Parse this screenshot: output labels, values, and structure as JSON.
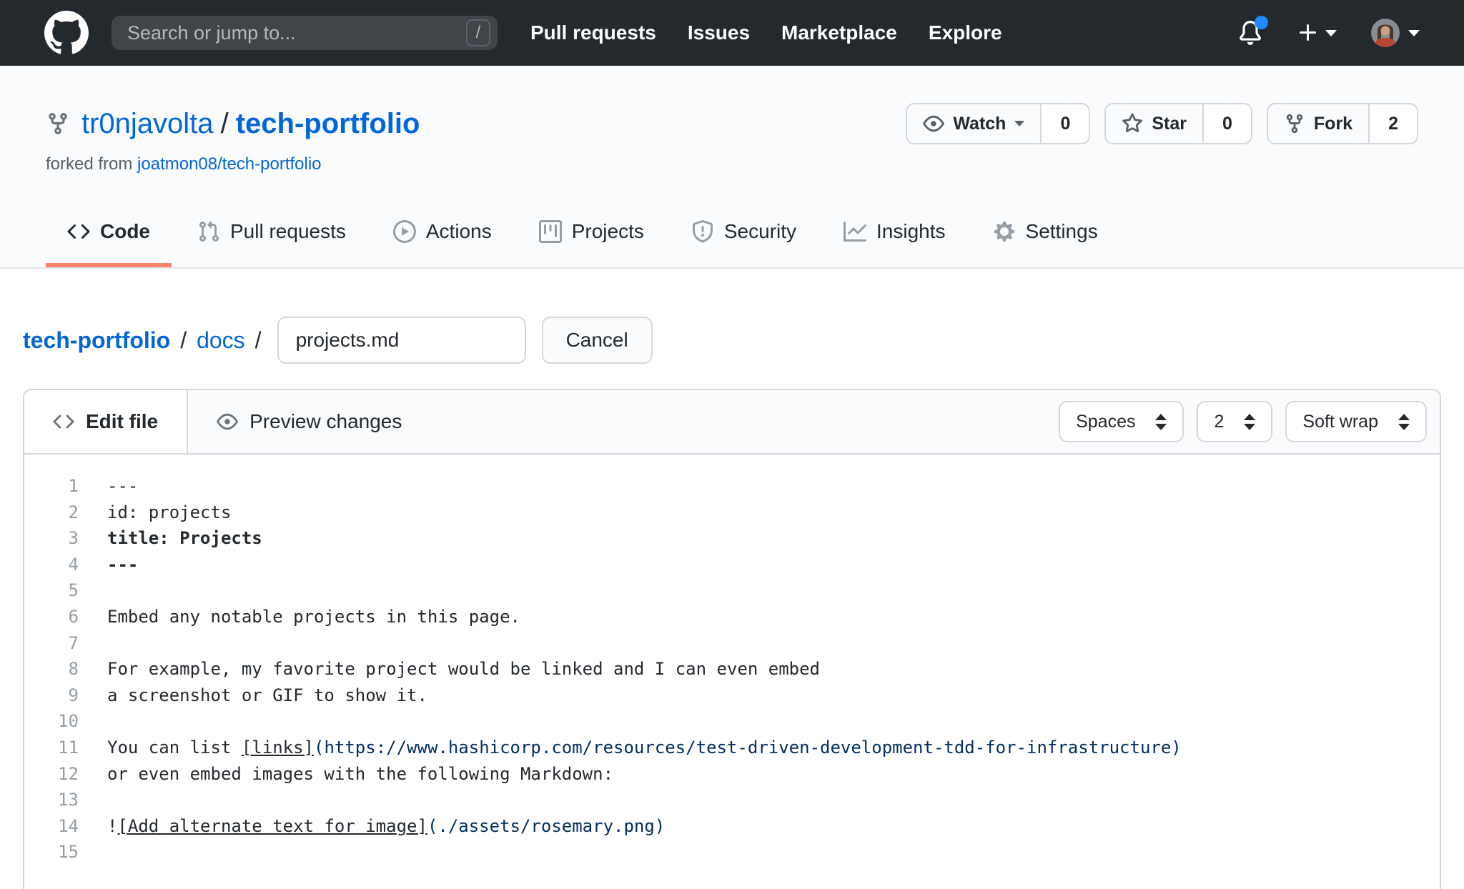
{
  "header": {
    "search": {
      "placeholder": "Search or jump to...",
      "shortcut": "/"
    },
    "nav": [
      "Pull requests",
      "Issues",
      "Marketplace",
      "Explore"
    ]
  },
  "repo": {
    "owner": "tr0njavolta",
    "separator": "/",
    "name": "tech-portfolio",
    "forked_from": {
      "label": "forked from",
      "link": "joatmon08/tech-portfolio"
    },
    "actions": [
      {
        "icon": "eye-icon",
        "label": "Watch",
        "caret": true,
        "count": "0"
      },
      {
        "icon": "star-icon",
        "label": "Star",
        "caret": false,
        "count": "0"
      },
      {
        "icon": "repo-forked-icon",
        "label": "Fork",
        "caret": false,
        "count": "2"
      }
    ],
    "tabs": [
      {
        "icon": "code-icon",
        "label": "Code",
        "active": true
      },
      {
        "icon": "git-pull-request-icon",
        "label": "Pull requests",
        "active": false
      },
      {
        "icon": "play-icon",
        "label": "Actions",
        "active": false
      },
      {
        "icon": "project-icon",
        "label": "Projects",
        "active": false
      },
      {
        "icon": "shield-icon",
        "label": "Security",
        "active": false
      },
      {
        "icon": "graph-icon",
        "label": "Insights",
        "active": false
      },
      {
        "icon": "gear-icon",
        "label": "Settings",
        "active": false
      }
    ]
  },
  "breadcrumb": {
    "repo": "tech-portfolio",
    "separator": "/",
    "folder": "docs",
    "filename": "projects.md",
    "cancel_label": "Cancel"
  },
  "editor": {
    "edit_tab": "Edit file",
    "preview_tab": "Preview changes",
    "settings": [
      {
        "name": "indent-mode-select",
        "value": "Spaces"
      },
      {
        "name": "indent-size-select",
        "value": "2"
      },
      {
        "name": "wrap-mode-select",
        "value": "Soft wrap"
      }
    ],
    "lines": [
      {
        "num": "1",
        "segments": [
          {
            "text": "---",
            "style": "plain"
          }
        ]
      },
      {
        "num": "2",
        "segments": [
          {
            "text": "id: projects",
            "style": "plain"
          }
        ]
      },
      {
        "num": "3",
        "segments": [
          {
            "text": "title: Projects",
            "style": "bold"
          }
        ]
      },
      {
        "num": "4",
        "segments": [
          {
            "text": "---",
            "style": "bold"
          }
        ]
      },
      {
        "num": "5",
        "segments": []
      },
      {
        "num": "6",
        "segments": [
          {
            "text": "Embed any notable projects in this page.",
            "style": "plain"
          }
        ]
      },
      {
        "num": "7",
        "segments": []
      },
      {
        "num": "8",
        "segments": [
          {
            "text": "For example, my favorite project would be linked and I can even embed",
            "style": "plain"
          }
        ]
      },
      {
        "num": "9",
        "segments": [
          {
            "text": "a screenshot or GIF to show it.",
            "style": "plain"
          }
        ]
      },
      {
        "num": "10",
        "segments": []
      },
      {
        "num": "11",
        "segments": [
          {
            "text": "You can list ",
            "style": "plain"
          },
          {
            "text": "[links]",
            "style": "link"
          },
          {
            "text": "(https://www.hashicorp.com/resources/test-driven-development-tdd-for-infrastructure)",
            "style": "url"
          }
        ]
      },
      {
        "num": "12",
        "segments": [
          {
            "text": "or even embed images with the following Markdown:",
            "style": "plain"
          }
        ]
      },
      {
        "num": "13",
        "segments": []
      },
      {
        "num": "14",
        "segments": [
          {
            "text": "!",
            "style": "plain"
          },
          {
            "text": "[Add alternate text for image]",
            "style": "link"
          },
          {
            "text": "(./assets/rosemary.png)",
            "style": "url"
          }
        ]
      },
      {
        "num": "15",
        "segments": []
      }
    ]
  },
  "colors": {
    "header_bg": "#24292e",
    "link": "#0366d6",
    "tab_underline": "#f9826c",
    "code_url": "#032f62",
    "notification_dot": "#2188ff"
  }
}
